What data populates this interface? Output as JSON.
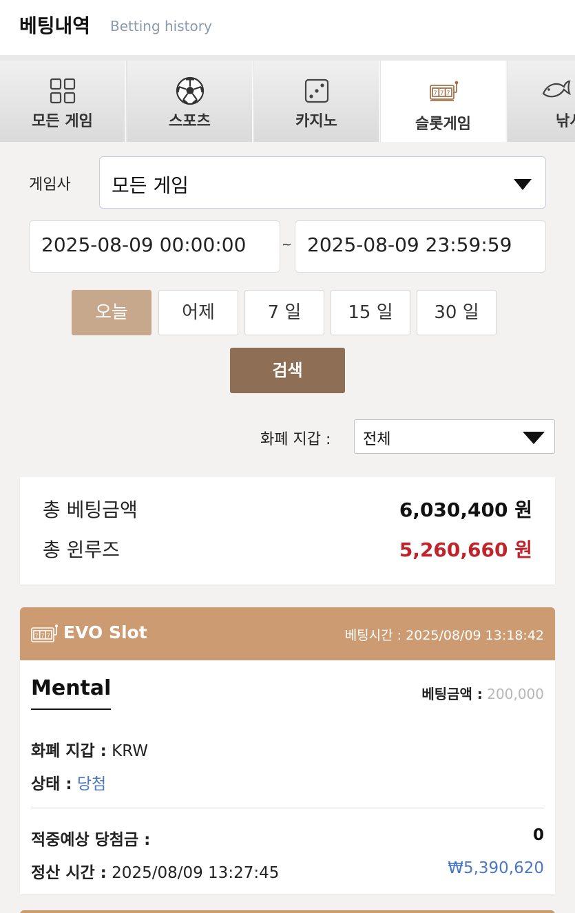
{
  "header": {
    "title": "베팅내역",
    "subtitle": "Betting history"
  },
  "tabs": [
    {
      "label": "모든 게임",
      "icon": "grid-icon",
      "active": false
    },
    {
      "label": "스포츠",
      "icon": "soccer-ball-icon",
      "active": false
    },
    {
      "label": "카지노",
      "icon": "dice-icon",
      "active": false
    },
    {
      "label": "슬롯게임",
      "icon": "slot-machine-icon",
      "active": true
    },
    {
      "label": "낚시",
      "icon": "fish-icon",
      "active": false
    }
  ],
  "filter": {
    "provider_label": "게임사",
    "provider_value": "모든 게임",
    "date_from": "2025-08-09 00:00:00",
    "date_separator": "~",
    "date_to": "2025-08-09 23:59:59",
    "quick_ranges": [
      "오늘",
      "어제",
      "7 일",
      "15 일",
      "30 일"
    ],
    "active_range": "오늘",
    "search_label": "검색",
    "wallet_label": "화폐 지갑 :",
    "wallet_value": "전체"
  },
  "summary": {
    "total_bet_label": "총 베팅금액",
    "total_bet_value": "6,030,400 원",
    "total_winloss_label": "총 윈루즈",
    "total_winloss_value": "5,260,660 원"
  },
  "bet": {
    "game": "EVO Slot",
    "bet_time_label": "베팅시간 :",
    "bet_time": "2025/08/09 13:18:42",
    "name": "Mental",
    "bet_amount_label": "베팅금액 :",
    "bet_amount": "200,000",
    "wallet_label": "화폐 지갑 :",
    "wallet": "KRW",
    "status_label": "상태 :",
    "status": "당첨",
    "expected_label": "적중예상 당첨금 :",
    "expected": "0",
    "settle_label": "정산 시간 :",
    "settle_time": "2025/08/09 13:27:45",
    "payout": "₩5,390,620"
  },
  "colors": {
    "accent": "#cc9b72",
    "search_button": "#8e6f55",
    "active_range": "#c7a88d",
    "winloss": "#c0232a",
    "link_blue": "#4a78c2"
  }
}
